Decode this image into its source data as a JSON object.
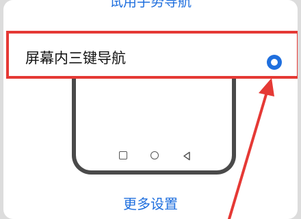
{
  "top_link": {
    "label": "试用手势导航"
  },
  "option": {
    "label": "屏幕内三键导航",
    "selected": true,
    "icon": "radio-selected-icon"
  },
  "preview": {
    "nav_icons": [
      "square-icon",
      "circle-icon",
      "back-triangle-icon"
    ]
  },
  "more_link": {
    "label": "更多设置"
  },
  "colors": {
    "accent": "#1f6fde",
    "annotation": "#e53935",
    "background": "#dcdcdc"
  }
}
